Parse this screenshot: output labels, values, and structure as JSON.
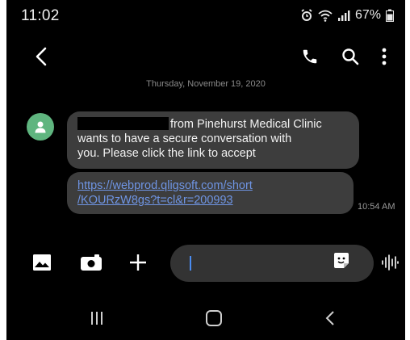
{
  "status_bar": {
    "time": "11:02",
    "battery_percent": "67%",
    "icons": [
      "alarm-icon",
      "wifi-icon",
      "signal-icon",
      "battery-icon"
    ]
  },
  "app_bar": {
    "icons": [
      "back-arrow-icon",
      "phone-call-icon",
      "search-icon",
      "more-vertical-icon"
    ]
  },
  "conversation": {
    "date": "Thursday, November 19, 2020",
    "messages": [
      {
        "line1_after_redaction": "from Pinehurst Medical Clinic",
        "line2": "wants to have a secure conversation with",
        "line3": "you. Please click the link to accept"
      },
      {
        "link_line1": "https://webprod.qligsoft.com/short",
        "link_line2": "/KOURzW8gs?t=cl&r=200993",
        "time": "10:54 AM"
      }
    ]
  },
  "composer": {
    "input_value": "",
    "icons": [
      "image-icon",
      "camera-icon",
      "plus-icon",
      "sticker-icon",
      "voice-wave-icon"
    ]
  },
  "nav_bar": {
    "icons": [
      "recents-icon",
      "home-icon",
      "nav-back-icon"
    ]
  },
  "colors": {
    "background": "#000000",
    "bubble": "#3d3d3d",
    "link": "#6f95e4",
    "avatar": "#5fb57f",
    "input_field": "#333333",
    "caret": "#4a8cf0"
  }
}
